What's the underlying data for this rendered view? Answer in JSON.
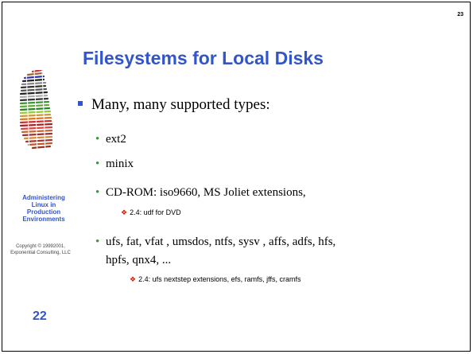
{
  "slide": {
    "top_page_number": "23",
    "title": "Filesystems for Local Disks",
    "bottom_page_number": "22",
    "side_title": [
      "Administering",
      "Linux in",
      "Production",
      "Environments"
    ],
    "copyright": [
      "Copyright © 19992001,",
      "Exponential Consulting, LLC"
    ]
  },
  "bullets": {
    "main": "Many, many supported types:",
    "items": [
      "ext2",
      "minix",
      "CD-ROM: iso9660, MS Joliet extensions,",
      "ufs, fat, vfat , umsdos, ntfs, sysv , affs, adfs, hfs,",
      "hpfs, qnx4, ..."
    ],
    "sub_items": [
      "2.4: udf  for DVD",
      "2.4: ufs nextstep extensions, efs, ramfs, jffs, cramfs"
    ]
  },
  "colors": {
    "title": "#3355cc",
    "bullet_square": "#3355cc",
    "bullet_dot": "#2f9f2f",
    "sub_bullet": "#cc2200"
  },
  "icons": {
    "logo": "penguin-stripes-logo",
    "level1_bullet": "square-bullet-icon",
    "level2_bullet": "dot-bullet-icon",
    "level3_bullet": "diamond-bullet-icon"
  }
}
